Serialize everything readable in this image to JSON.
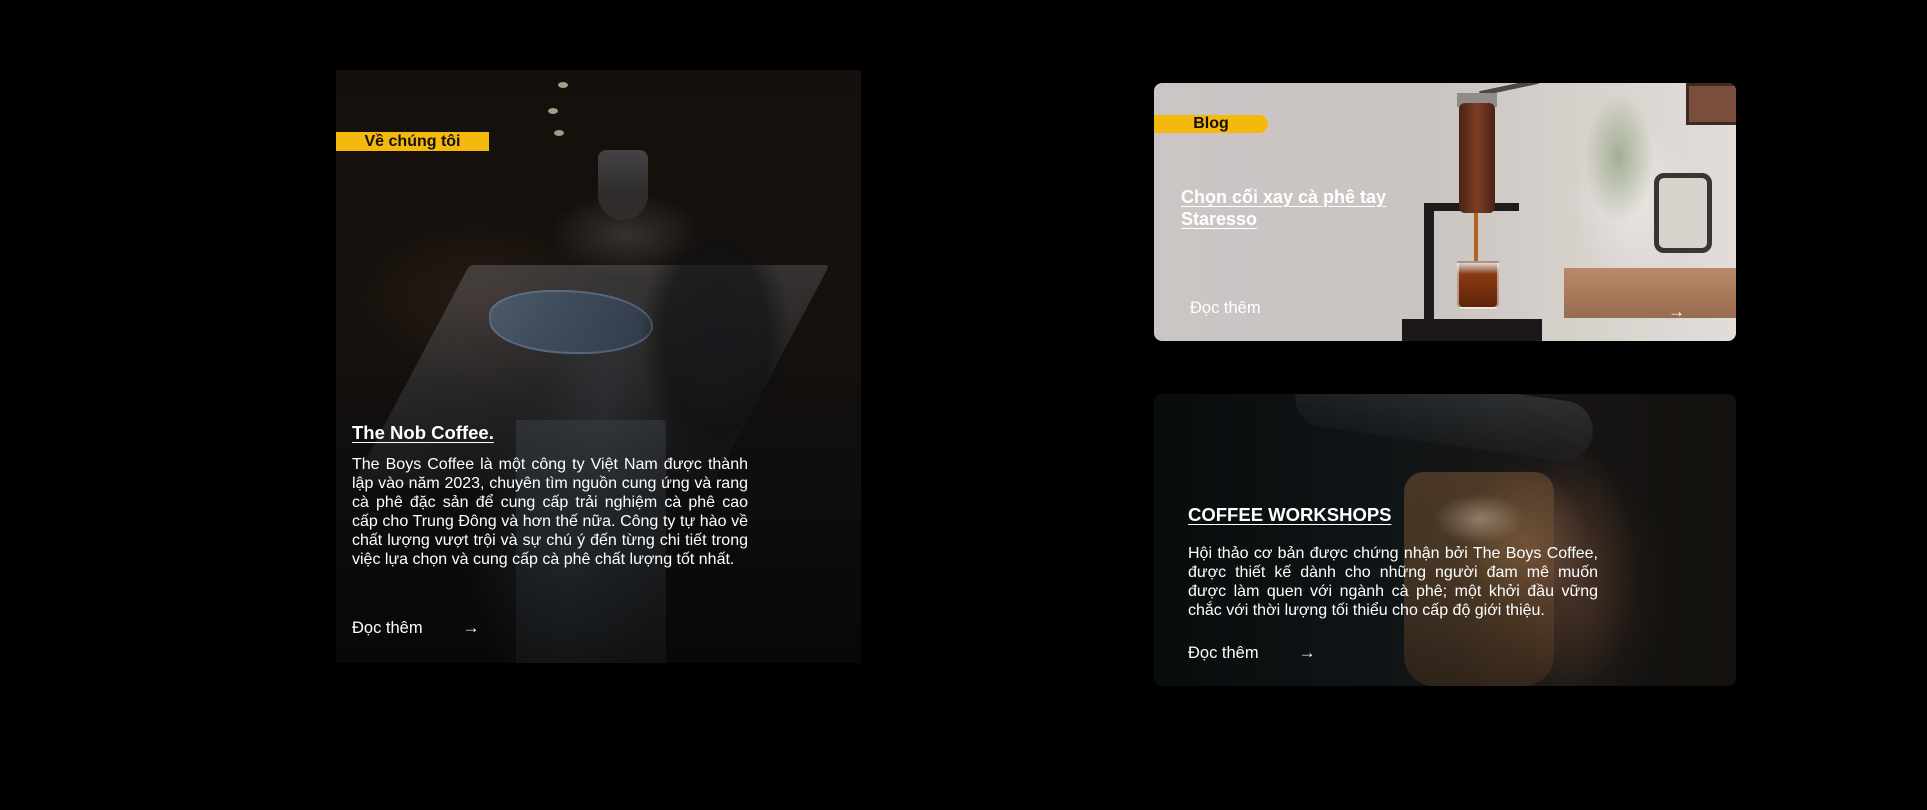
{
  "about": {
    "tag": "Về chúng tôi",
    "title": "The Nob Coffee.",
    "text": "The Boys Coffee là một công ty Việt Nam được thành lập vào năm 2023, chuyên tìm nguồn cung ứng và rang cà phê đặc sản để cung cấp trải nghiệm cà phê cao cấp cho Trung Đông và hơn thế nữa. Công ty tự hào về chất lượng vượt trội và sự chú ý đến từng chi tiết trong việc lựa chọn và cung cấp cà phê chất lượng tốt nhất.",
    "read_more": "Đọc thêm",
    "arrow": "→"
  },
  "blog": {
    "tag": "Blog",
    "title": "Chọn cối xay cà phê tay Staresso",
    "read_more": "Đọc thêm",
    "arrow": "→"
  },
  "workshop": {
    "title": "COFFEE WORKSHOPS",
    "text": "Hội thảo cơ bản được chứng nhận bởi The Boys Coffee, được thiết kế dành cho những người đam mê muốn được làm quen với ngành cà phê; một khởi đầu vững chắc với thời lượng tối thiểu cho cấp độ giới thiệu.",
    "read_more": "Đọc thêm",
    "arrow": "→"
  },
  "colors": {
    "accent": "#f5b90e",
    "background": "#000000",
    "text": "#ffffff"
  }
}
